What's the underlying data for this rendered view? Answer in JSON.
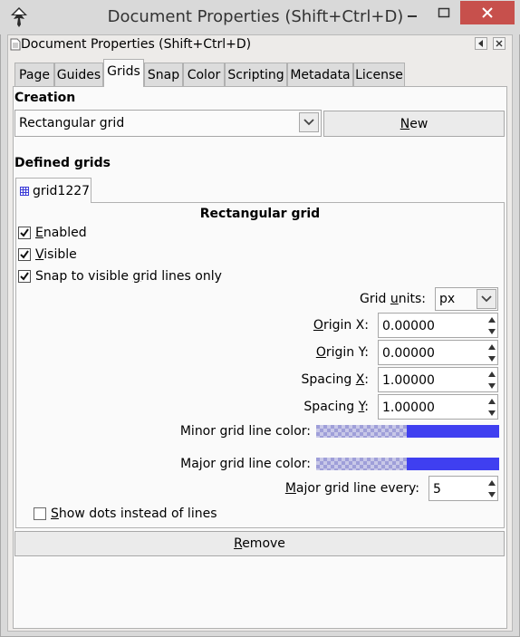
{
  "window": {
    "title": "Document Properties (Shift+Ctrl+D)",
    "icon": "inkscape-icon"
  },
  "dock": {
    "title": "Document Properties (Shift+Ctrl+D)"
  },
  "tabs": [
    "Page",
    "Guides",
    "Grids",
    "Snap",
    "Color",
    "Scripting",
    "Metadata",
    "License"
  ],
  "active_tab": "Grids",
  "creation": {
    "heading": "Creation",
    "grid_type": "Rectangular grid",
    "new_button": "New",
    "new_mnemonic": "N"
  },
  "defined": {
    "heading": "Defined grids",
    "grid_tab": "grid1227",
    "grid_type_title": "Rectangular grid"
  },
  "options": {
    "enabled": {
      "label": "Enabled",
      "mnemonic": "E",
      "checked": true
    },
    "visible": {
      "label": "Visible",
      "mnemonic": "V",
      "checked": true
    },
    "snap": {
      "pre": "Snap to visible ",
      "mnemonic": "g",
      "post": "rid lines only",
      "checked": true
    },
    "dots": {
      "label": "Show dots instead of lines",
      "mnemonic": "S",
      "checked": false
    }
  },
  "fields": {
    "units": {
      "pre": "Grid ",
      "mnemonic": "u",
      "post": "nits:",
      "value": "px"
    },
    "origin_x": {
      "mnemonic": "O",
      "post": "rigin X:",
      "value": "0.00000"
    },
    "origin_y": {
      "mnemonic": "O",
      "post": "rigin Y:",
      "value": "0.00000"
    },
    "spacing_x": {
      "pre": "Spacing ",
      "mnemonic": "X",
      "post": ":",
      "value": "1.00000"
    },
    "spacing_y": {
      "pre": "Spacing ",
      "mnemonic": "Y",
      "post": ":",
      "value": "1.00000"
    },
    "minor_color": {
      "label": "Minor grid line color:",
      "color": "#3f3ff0"
    },
    "major_color": {
      "label": "Major grid line color:",
      "color": "#3f3ff0"
    },
    "major_every": {
      "mnemonic": "M",
      "post": "ajor grid line every:",
      "value": "5"
    }
  },
  "remove_button": {
    "mnemonic": "R",
    "post": "emove"
  }
}
